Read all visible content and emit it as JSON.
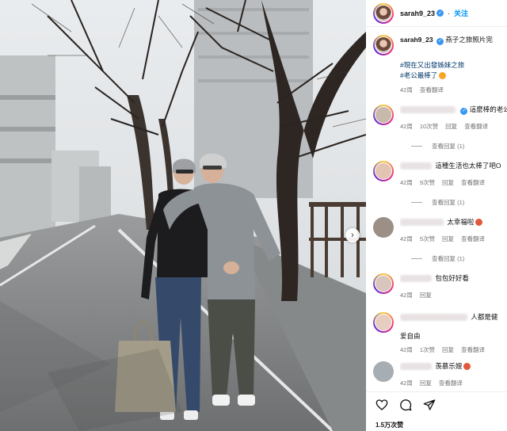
{
  "header": {
    "username": "sarah9_23",
    "follow_label": "关注"
  },
  "caption": {
    "username": "sarah9_23",
    "text": "燕子之旅照片完",
    "hashtag1": "#現在又出發姊妹之旅",
    "hashtag2": "#老公最棒了",
    "time": "42周",
    "translate": "查看翻译"
  },
  "comments": [
    {
      "text": "這麼棒的老公",
      "time": "42周",
      "likes": "10次赞",
      "reply": "回复",
      "translate": "查看翻译",
      "replies": "查看回复 (1)"
    },
    {
      "text": "這種生活也太棒了吧O",
      "time": "42周",
      "likes": "9次赞",
      "reply": "回复",
      "translate": "查看翻译",
      "replies": "查看回复 (1)"
    },
    {
      "text": "太幸福啦",
      "time": "42周",
      "likes": "5次赞",
      "reply": "回复",
      "translate": "查看翻译",
      "replies": "查看回复 (1)"
    },
    {
      "text": "包包好好看",
      "time": "42周",
      "reply": "回复"
    },
    {
      "text": "人都是健",
      "text2": "爱自由",
      "time": "42周",
      "likes": "1次赞",
      "reply": "回复",
      "translate": "查看翻译"
    },
    {
      "text": "羡慕乐嫂",
      "time": "42周",
      "reply": "回复",
      "translate": "查看翻译"
    }
  ],
  "footer": {
    "likes": "1.5万次赞"
  },
  "icons": {
    "verified": "verified-badge-icon",
    "next": "chevron-right-icon",
    "like": "heart-icon",
    "comment": "comment-bubble-icon",
    "share": "paper-plane-icon"
  },
  "colors": {
    "accent": "#0095f6",
    "verified": "#3897f0",
    "hashtag": "#00376b",
    "muted": "#737373"
  }
}
